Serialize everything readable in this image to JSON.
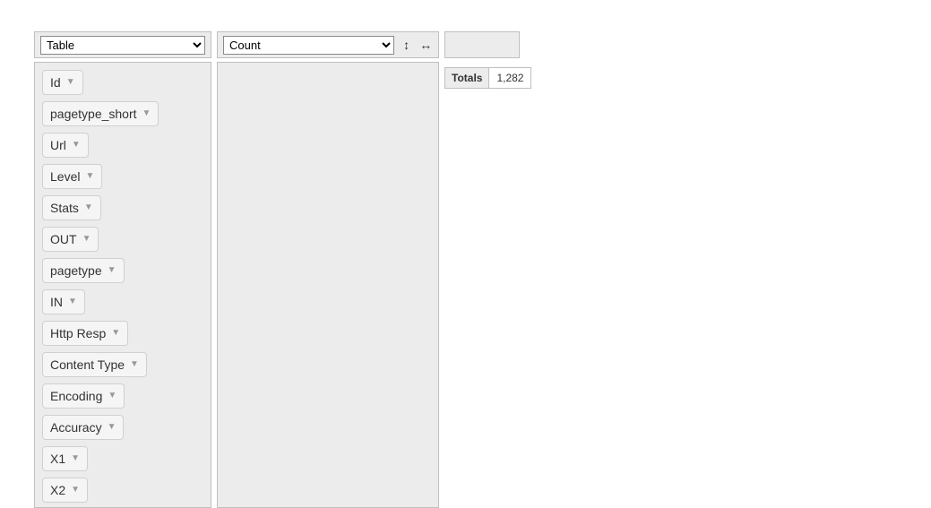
{
  "controls": {
    "renderer_selected": "Table",
    "aggregator_selected": "Count"
  },
  "unused_attrs": [
    "Id",
    "pagetype_short",
    "Url",
    "Level",
    "Stats",
    "OUT",
    "pagetype",
    "IN",
    "Http Resp",
    "Content Type",
    "Encoding",
    "Accuracy",
    "X1",
    "X2"
  ],
  "output": {
    "totals_label": "Totals",
    "totals_value": "1,282"
  }
}
